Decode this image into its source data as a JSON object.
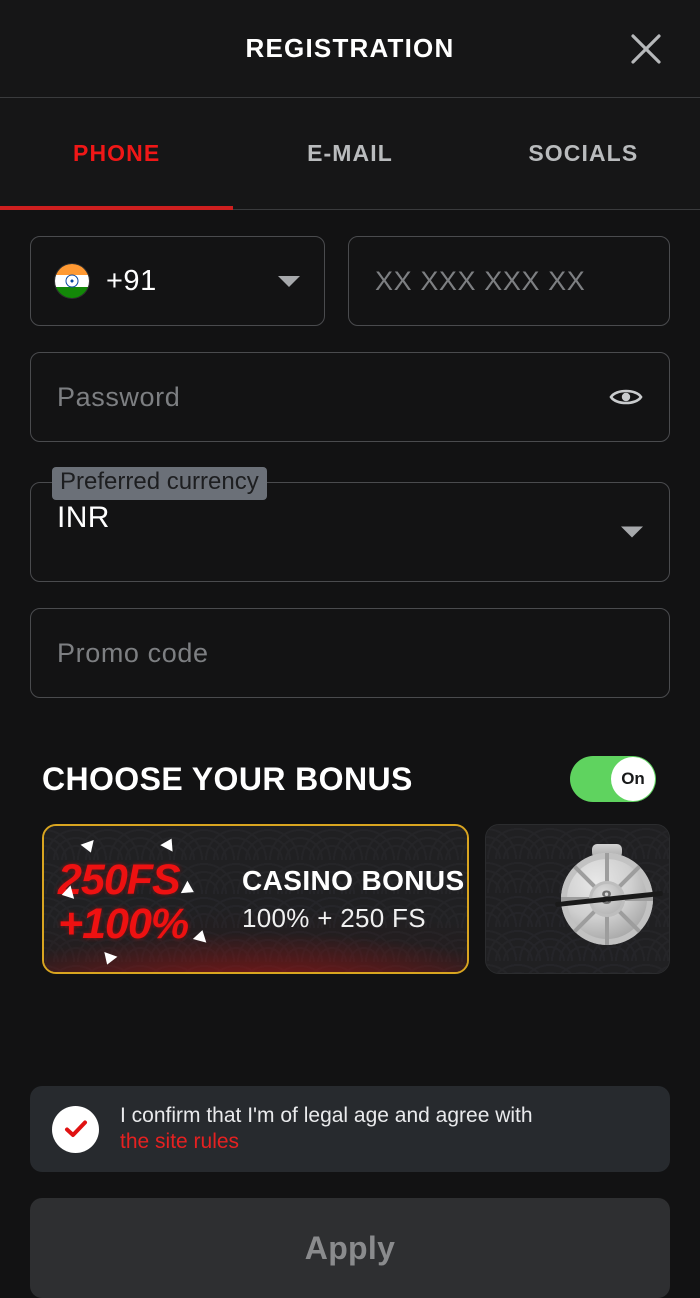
{
  "header": {
    "title": "REGISTRATION",
    "close_icon": "close-icon"
  },
  "tabs": [
    {
      "label": "PHONE",
      "active": true
    },
    {
      "label": "E-MAIL",
      "active": false
    },
    {
      "label": "SOCIALS",
      "active": false
    }
  ],
  "form": {
    "country_code": {
      "flag_icon": "india-flag-icon",
      "value": "+91",
      "caret_icon": "chevron-down-icon"
    },
    "phone": {
      "value": "",
      "placeholder": "XX XXX XXX XX"
    },
    "password": {
      "value": "",
      "placeholder": "Password",
      "reveal_icon": "eye-icon"
    },
    "currency": {
      "label": "Preferred currency",
      "value": "INR",
      "caret_icon": "chevron-down-icon"
    },
    "promo": {
      "value": "",
      "placeholder": "Promo code"
    }
  },
  "bonus": {
    "title": "CHOOSE YOUR BONUS",
    "toggle_label": "On",
    "toggle_on": true,
    "cards": [
      {
        "art_line1": "250FS",
        "art_line2": "+100%",
        "title": "CASINO BONUS",
        "subtitle": "100% + 250 FS",
        "selected": true
      },
      {
        "icon": "roulette-wheel-icon",
        "hub_label": "8",
        "selected": false
      }
    ]
  },
  "consent": {
    "checked": true,
    "check_icon": "checkmark-icon",
    "text": "I confirm that I'm of legal age and agree with",
    "link_text": "the site rules"
  },
  "submit": {
    "label": "Apply",
    "disabled": true
  },
  "colors": {
    "accent_red": "#f01717",
    "gold_border": "#d9a520",
    "toggle_green": "#5FD35F",
    "background": "#121213"
  }
}
